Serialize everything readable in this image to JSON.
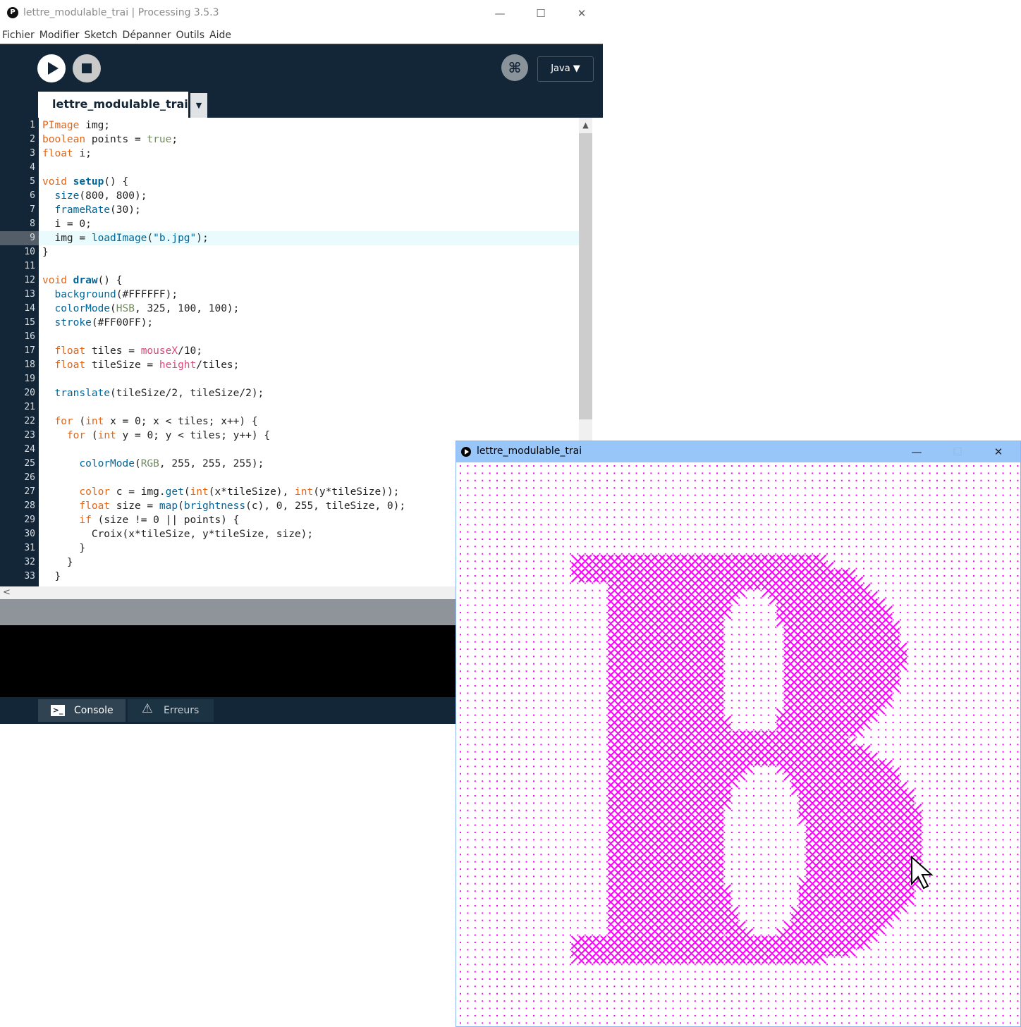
{
  "ide": {
    "title": "lettre_modulable_trai | Processing 3.5.3",
    "app_logo_glyph": "P",
    "window_controls": {
      "minimize": "—",
      "maximize": "☐",
      "close": "✕"
    },
    "menu": [
      "Fichier",
      "Modifier",
      "Sketch",
      "Dépanner",
      "Outils",
      "Aide"
    ],
    "toolbar": {
      "debug_glyph": "⌘",
      "mode_label": "Java ▼"
    },
    "tab_label": "lettre_modulable_trai",
    "tab_menu_glyph": "▼",
    "scroll": {
      "up": "▲",
      "left": "<"
    },
    "active_line": 9,
    "code": [
      "PImage img;",
      "boolean points = true;",
      "float i;",
      "",
      "void setup() {",
      "  size(800, 800);",
      "  frameRate(30);",
      "  i = 0;",
      "  img = loadImage(\"b.jpg\");",
      "}",
      "",
      "void draw() {",
      "  background(#FFFFFF);",
      "  colorMode(HSB, 325, 100, 100);",
      "  stroke(#FF00FF);",
      "",
      "  float tiles = mouseX/10;",
      "  float tileSize = height/tiles;",
      "",
      "  translate(tileSize/2, tileSize/2);",
      "",
      "  for (int x = 0; x < tiles; x++) {",
      "    for (int y = 0; y < tiles; y++) {",
      "",
      "      colorMode(RGB, 255, 255, 255);",
      "",
      "      color c = img.get(int(x*tileSize), int(y*tileSize));",
      "      float size = map(brightness(c), 0, 255, tileSize, 0);",
      "      if (size != 0 || points) {",
      "        Croix(x*tileSize, y*tileSize, size);",
      "      }",
      "    }",
      "  }"
    ],
    "footer_tabs": [
      {
        "label": "Console",
        "icon": "console-icon",
        "glyph": ">_"
      },
      {
        "label": "Erreurs",
        "icon": "warning-icon",
        "glyph": "⚠"
      }
    ]
  },
  "sketch": {
    "title": "lettre_modulable_trai",
    "window_controls": {
      "minimize": "—",
      "maximize": "☐",
      "close": "✕"
    },
    "stroke_color": "#FF00FF"
  },
  "colors": {
    "ide_dark": "#132638",
    "keyword_orange": "#E2661A",
    "function_teal": "#33997E",
    "sketch_title_bar": "#99C6F9"
  }
}
